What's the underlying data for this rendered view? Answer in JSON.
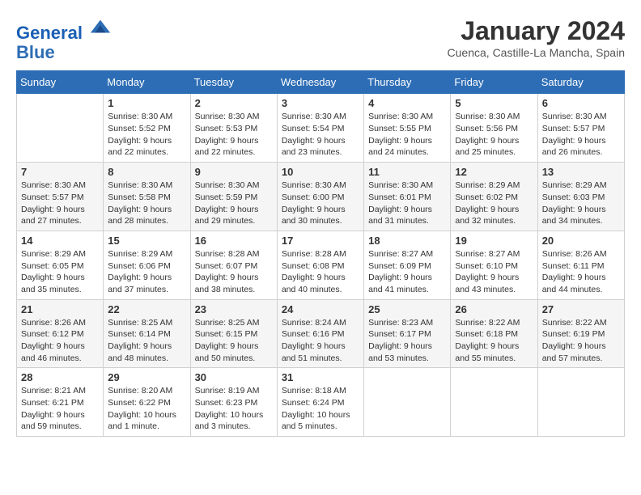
{
  "header": {
    "logo_line1": "General",
    "logo_line2": "Blue",
    "month_title": "January 2024",
    "location": "Cuenca, Castille-La Mancha, Spain"
  },
  "weekdays": [
    "Sunday",
    "Monday",
    "Tuesday",
    "Wednesday",
    "Thursday",
    "Friday",
    "Saturday"
  ],
  "weeks": [
    [
      {
        "day": "",
        "info": ""
      },
      {
        "day": "1",
        "info": "Sunrise: 8:30 AM\nSunset: 5:52 PM\nDaylight: 9 hours\nand 22 minutes."
      },
      {
        "day": "2",
        "info": "Sunrise: 8:30 AM\nSunset: 5:53 PM\nDaylight: 9 hours\nand 22 minutes."
      },
      {
        "day": "3",
        "info": "Sunrise: 8:30 AM\nSunset: 5:54 PM\nDaylight: 9 hours\nand 23 minutes."
      },
      {
        "day": "4",
        "info": "Sunrise: 8:30 AM\nSunset: 5:55 PM\nDaylight: 9 hours\nand 24 minutes."
      },
      {
        "day": "5",
        "info": "Sunrise: 8:30 AM\nSunset: 5:56 PM\nDaylight: 9 hours\nand 25 minutes."
      },
      {
        "day": "6",
        "info": "Sunrise: 8:30 AM\nSunset: 5:57 PM\nDaylight: 9 hours\nand 26 minutes."
      }
    ],
    [
      {
        "day": "7",
        "info": ""
      },
      {
        "day": "8",
        "info": "Sunrise: 8:30 AM\nSunset: 5:58 PM\nDaylight: 9 hours\nand 28 minutes."
      },
      {
        "day": "9",
        "info": "Sunrise: 8:30 AM\nSunset: 5:59 PM\nDaylight: 9 hours\nand 29 minutes."
      },
      {
        "day": "10",
        "info": "Sunrise: 8:30 AM\nSunset: 6:00 PM\nDaylight: 9 hours\nand 30 minutes."
      },
      {
        "day": "11",
        "info": "Sunrise: 8:30 AM\nSunset: 6:01 PM\nDaylight: 9 hours\nand 31 minutes."
      },
      {
        "day": "12",
        "info": "Sunrise: 8:29 AM\nSunset: 6:02 PM\nDaylight: 9 hours\nand 32 minutes."
      },
      {
        "day": "13",
        "info": "Sunrise: 8:29 AM\nSunset: 6:03 PM\nDaylight: 9 hours\nand 34 minutes."
      }
    ],
    [
      {
        "day": "14",
        "info": ""
      },
      {
        "day": "15",
        "info": "Sunrise: 8:29 AM\nSunset: 6:06 PM\nDaylight: 9 hours\nand 37 minutes."
      },
      {
        "day": "16",
        "info": "Sunrise: 8:28 AM\nSunset: 6:07 PM\nDaylight: 9 hours\nand 38 minutes."
      },
      {
        "day": "17",
        "info": "Sunrise: 8:28 AM\nSunset: 6:08 PM\nDaylight: 9 hours\nand 40 minutes."
      },
      {
        "day": "18",
        "info": "Sunrise: 8:27 AM\nSunset: 6:09 PM\nDaylight: 9 hours\nand 41 minutes."
      },
      {
        "day": "19",
        "info": "Sunrise: 8:27 AM\nSunset: 6:10 PM\nDaylight: 9 hours\nand 43 minutes."
      },
      {
        "day": "20",
        "info": "Sunrise: 8:26 AM\nSunset: 6:11 PM\nDaylight: 9 hours\nand 44 minutes."
      }
    ],
    [
      {
        "day": "21",
        "info": ""
      },
      {
        "day": "22",
        "info": "Sunrise: 8:25 AM\nSunset: 6:14 PM\nDaylight: 9 hours\nand 48 minutes."
      },
      {
        "day": "23",
        "info": "Sunrise: 8:25 AM\nSunset: 6:15 PM\nDaylight: 9 hours\nand 50 minutes."
      },
      {
        "day": "24",
        "info": "Sunrise: 8:24 AM\nSunset: 6:16 PM\nDaylight: 9 hours\nand 51 minutes."
      },
      {
        "day": "25",
        "info": "Sunrise: 8:23 AM\nSunset: 6:17 PM\nDaylight: 9 hours\nand 53 minutes."
      },
      {
        "day": "26",
        "info": "Sunrise: 8:22 AM\nSunset: 6:18 PM\nDaylight: 9 hours\nand 55 minutes."
      },
      {
        "day": "27",
        "info": "Sunrise: 8:22 AM\nSunset: 6:19 PM\nDaylight: 9 hours\nand 57 minutes."
      }
    ],
    [
      {
        "day": "28",
        "info": ""
      },
      {
        "day": "29",
        "info": "Sunrise: 8:20 AM\nSunset: 6:22 PM\nDaylight: 10 hours\nand 1 minute."
      },
      {
        "day": "30",
        "info": "Sunrise: 8:19 AM\nSunset: 6:23 PM\nDaylight: 10 hours\nand 3 minutes."
      },
      {
        "day": "31",
        "info": "Sunrise: 8:18 AM\nSunset: 6:24 PM\nDaylight: 10 hours\nand 5 minutes."
      },
      {
        "day": "",
        "info": ""
      },
      {
        "day": "",
        "info": ""
      },
      {
        "day": "",
        "info": ""
      }
    ]
  ],
  "week0_day7_info": "Sunrise: 8:30 AM\nSunset: 5:57 PM\nDaylight: 9 hours\nand 27 minutes.",
  "week1_day0_info": "Sunrise: 8:30 AM\nSunset: 5:57 PM\nDaylight: 9 hours\nand 27 minutes.",
  "week2_day0_info": "Sunrise: 8:29 AM\nSunset: 6:05 PM\nDaylight: 9 hours\nand 35 minutes.",
  "week3_day0_info": "Sunrise: 8:26 AM\nSunset: 6:12 PM\nDaylight: 9 hours\nand 46 minutes.",
  "week4_day0_info": "Sunrise: 8:21 AM\nSunset: 6:21 PM\nDaylight: 9 hours\nand 59 minutes."
}
